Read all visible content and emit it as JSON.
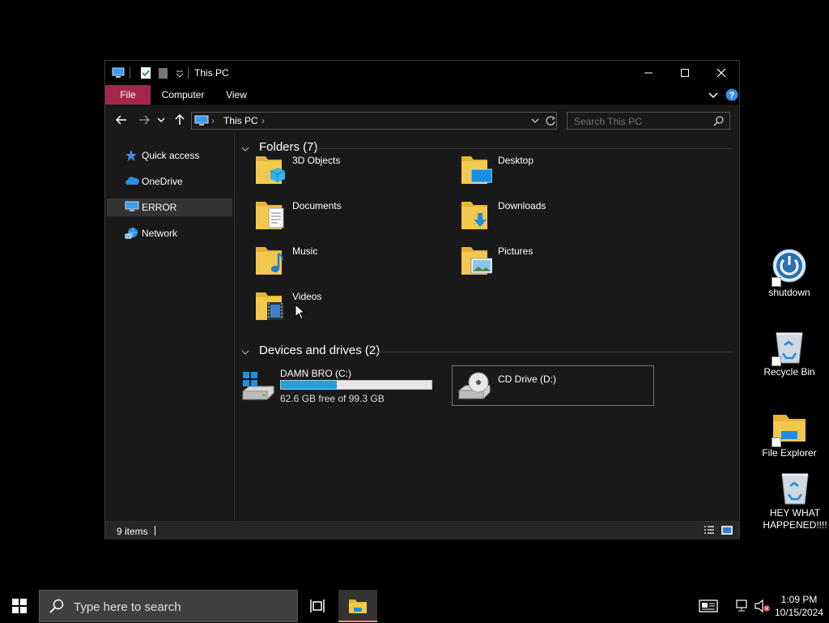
{
  "window": {
    "title": "This PC",
    "ribbon": {
      "tabs": [
        "File",
        "Computer",
        "View"
      ]
    },
    "address": {
      "crumbs": [
        "This PC"
      ]
    },
    "search": {
      "placeholder": "Search This PC"
    },
    "nav_pane": {
      "items": [
        {
          "label": "Quick access",
          "icon": "star-icon"
        },
        {
          "label": "OneDrive",
          "icon": "cloud-icon"
        },
        {
          "label": "ERROR",
          "icon": "computer-icon",
          "selected": true
        },
        {
          "label": "Network",
          "icon": "network-icon"
        }
      ]
    },
    "folders": {
      "title": "Folders (7)",
      "items": [
        {
          "label": "3D Objects",
          "icon": "3d-objects-folder-icon"
        },
        {
          "label": "Desktop",
          "icon": "desktop-folder-icon"
        },
        {
          "label": "Documents",
          "icon": "documents-folder-icon"
        },
        {
          "label": "Downloads",
          "icon": "downloads-folder-icon"
        },
        {
          "label": "Music",
          "icon": "music-folder-icon"
        },
        {
          "label": "Pictures",
          "icon": "pictures-folder-icon"
        },
        {
          "label": "Videos",
          "icon": "videos-folder-icon"
        }
      ]
    },
    "devices": {
      "title": "Devices and drives (2)",
      "items": [
        {
          "label": "DAMN BRO (C:)",
          "free_text": "62.6 GB free of 99.3 GB",
          "used_fraction": 0.37,
          "icon": "windows-drive-icon"
        },
        {
          "label": "CD Drive (D:)",
          "icon": "cd-drive-icon"
        }
      ]
    },
    "status": {
      "text": "9 items"
    }
  },
  "desktop_icons": [
    {
      "label": "shutdown",
      "icon": "power-icon"
    },
    {
      "label": "Recycle Bin",
      "icon": "recycle-bin-icon"
    },
    {
      "label": "File Explorer",
      "icon": "file-explorer-icon"
    },
    {
      "label": "HEY WHAT HAPPENED!!!!",
      "icon": "recycle-bin-icon"
    }
  ],
  "taskbar": {
    "search_placeholder": "Type here to search",
    "clock": {
      "time": "1:09 PM",
      "date": "10/15/2024"
    }
  },
  "colors": {
    "accent_file_tab": "#a5264b",
    "drive_bar": "#26a0da",
    "folder_yellow": "#f3c94d"
  }
}
